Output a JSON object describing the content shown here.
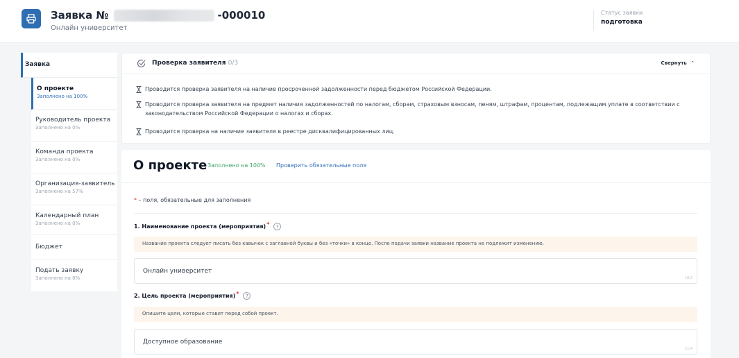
{
  "header": {
    "title_prefix": "Заявка №",
    "title_suffix": "-000010",
    "subtitle": "Онлайн университет",
    "status_label": "Статус заявки",
    "status_value": "подготовка"
  },
  "sidebar": {
    "section_title": "Заявка",
    "items": [
      {
        "label": "О проекте",
        "sub": "Заполнено на 100%"
      },
      {
        "label": "Руководитель проекта",
        "sub": "Заполнено на 0%"
      },
      {
        "label": "Команда проекта",
        "sub": "Заполнено на 0%"
      },
      {
        "label": "Организация-заявитель",
        "sub": "Заполнено на 57%"
      },
      {
        "label": "Календарный план",
        "sub": "Заполнено на 0%"
      },
      {
        "label": "Бюджет"
      },
      {
        "label": "Подать заявку",
        "sub": "Заполнено на 0%"
      }
    ]
  },
  "check_panel": {
    "title": "Проверка заявителя",
    "count": "0/3",
    "collapse_label": "Свернуть",
    "items": [
      "Проводится проверка заявителя на наличие просроченной задолженности перед бюджетом Российской Федерации.",
      "Проводится проверка заявителя на предмет наличия задолженностей по налогам, сборам, страховым взносам, пеням, штрафам, процентам, подлежащим уплате в соответствии с законодательством Российской Федерации о налогах и сборах.",
      "Проводится проверка на наличие заявителя в реестре дисквалифицированных лиц."
    ]
  },
  "main": {
    "title": "О проекте",
    "filled": "Заполнено на 100%",
    "check_link": "Проверить обязательные поля",
    "required_star": "*",
    "required_note": " – поля, обязательные для заполнения",
    "fields": [
      {
        "label": "1. Наименование проекта (мероприятия)",
        "hint": "Название проекта следует писать без кавычек с заглавной буквы и без «точки» в конце. После подачи заявки название проекта не подлежит изменению.",
        "value": "Онлайн университет",
        "counter": "18/2"
      },
      {
        "label": "2. Цель проекта (мероприятия)",
        "hint": "Опишите цели, которые ставит перед собой проект.",
        "value": "Доступное образование",
        "counter": "21/4"
      }
    ]
  },
  "colors": {
    "accent": "#2f6db3",
    "success": "#3fa66b",
    "required": "#e03131",
    "hint_bg": "#fdf4ec"
  }
}
